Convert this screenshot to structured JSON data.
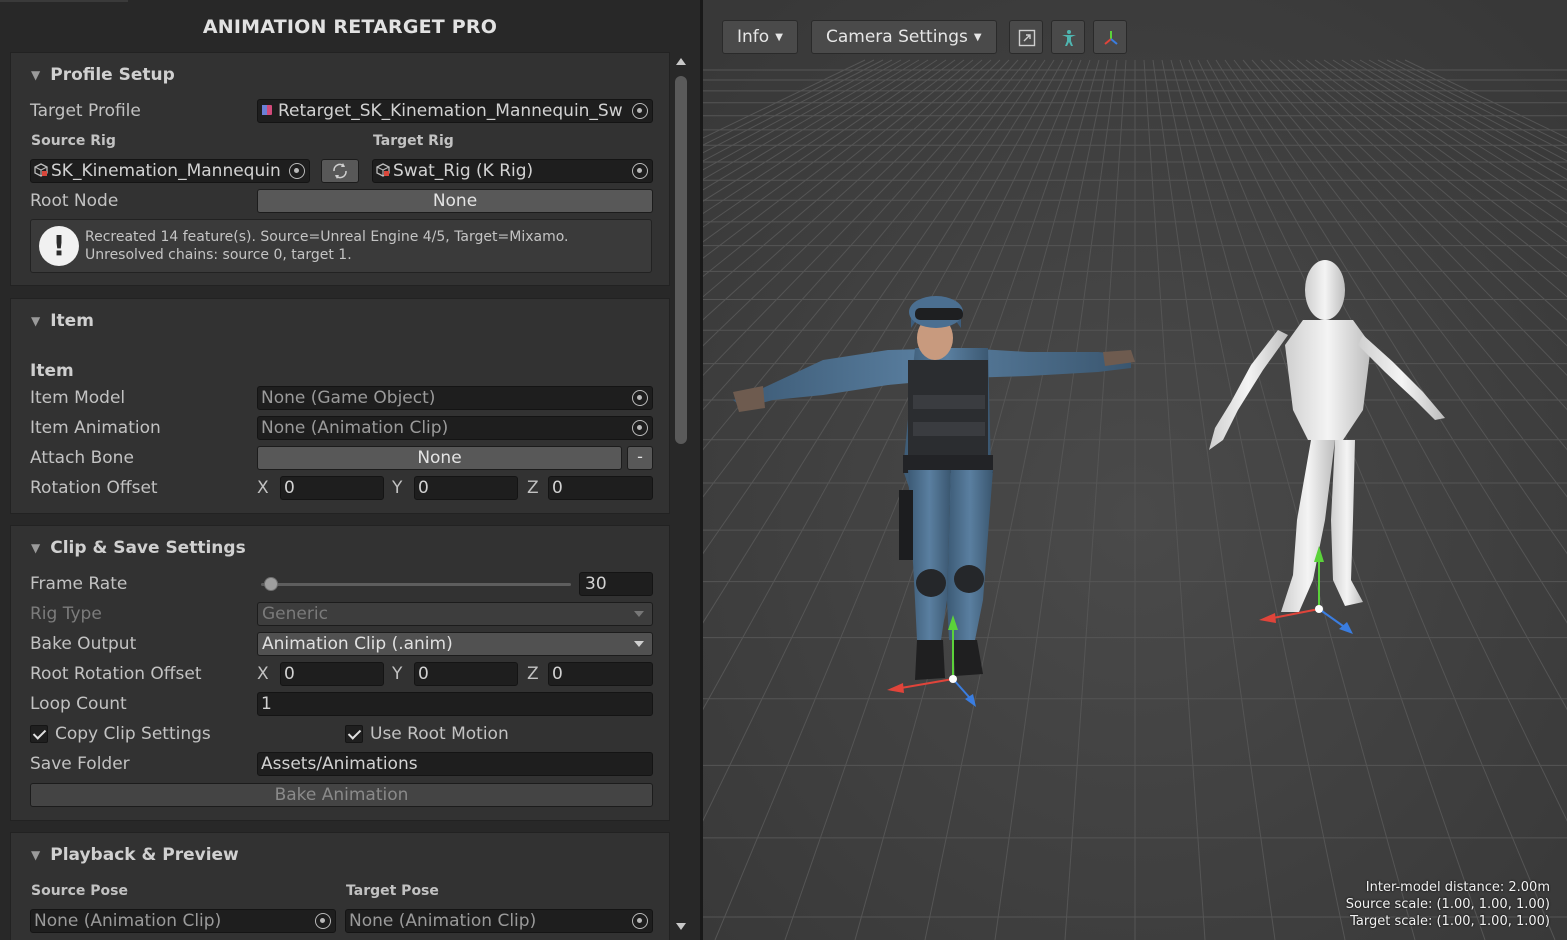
{
  "app": {
    "title": "ANIMATION RETARGET PRO"
  },
  "profile_setup": {
    "header": "Profile Setup",
    "target_profile_label": "Target Profile",
    "target_profile_value": "Retarget_SK_Kinemation_Mannequin_Sw",
    "source_rig_label": "Source Rig",
    "source_rig_value": "SK_Kinemation_Mannequin",
    "target_rig_label": "Target Rig",
    "target_rig_value": "Swat_Rig (K Rig)",
    "root_node_label": "Root Node",
    "root_node_value": "None",
    "help_line1": "Recreated 14 feature(s). Source=Unreal Engine 4/5, Target=Mixamo.",
    "help_line2": "Unresolved chains: source 0, target 1."
  },
  "item": {
    "header": "Item",
    "group_label": "Item",
    "item_model_label": "Item Model",
    "item_model_value": "None (Game Object)",
    "item_animation_label": "Item Animation",
    "item_animation_value": "None (Animation Clip)",
    "attach_bone_label": "Attach Bone",
    "attach_bone_value": "None",
    "attach_bone_minus": "-",
    "rotation_offset_label": "Rotation Offset",
    "rotation": {
      "x_label": "X",
      "x": "0",
      "y_label": "Y",
      "y": "0",
      "z_label": "Z",
      "z": "0"
    }
  },
  "clip_save": {
    "header": "Clip & Save Settings",
    "frame_rate_label": "Frame Rate",
    "frame_rate_value": "30",
    "frame_rate_slider_fraction": 0.02,
    "rig_type_label": "Rig Type",
    "rig_type_value": "Generic",
    "bake_output_label": "Bake Output",
    "bake_output_value": "Animation Clip (.anim)",
    "root_rotation_label": "Root Rotation Offset",
    "root_rotation": {
      "x_label": "X",
      "x": "0",
      "y_label": "Y",
      "y": "0",
      "z_label": "Z",
      "z": "0"
    },
    "loop_count_label": "Loop Count",
    "loop_count_value": "1",
    "copy_clip_label": "Copy Clip Settings",
    "copy_clip_checked": true,
    "use_root_motion_label": "Use Root Motion",
    "use_root_motion_checked": true,
    "save_folder_label": "Save Folder",
    "save_folder_value": "Assets/Animations",
    "bake_button": "Bake Animation"
  },
  "playback": {
    "header": "Playback & Preview",
    "source_pose_label": "Source Pose",
    "source_pose_value": "None (Animation Clip)",
    "target_pose_label": "Target Pose",
    "target_pose_value": "None (Animation Clip)"
  },
  "viewport": {
    "info_button": "Info",
    "camera_button": "Camera Settings",
    "icons": [
      "maximize-icon",
      "humanoid-icon",
      "axes-gizmo-icon"
    ],
    "hud_distance": "Inter-model distance: 2.00m",
    "hud_source_scale": "Source scale: (1.00, 1.00, 1.00)",
    "hud_target_scale": "Target scale: (1.00, 1.00, 1.00)"
  },
  "colors": {
    "panel_bg": "#282828",
    "section_bg": "#323232",
    "field_bg": "#1e1e1e",
    "button_bg": "#585858",
    "viewport_bg": "#3f3f3f",
    "swat_blue": "#4d6f8e",
    "mannequin_white": "#e6e6e6",
    "axis_x": "#e0443a",
    "axis_y": "#5bd23a",
    "axis_z": "#3a7de0"
  }
}
